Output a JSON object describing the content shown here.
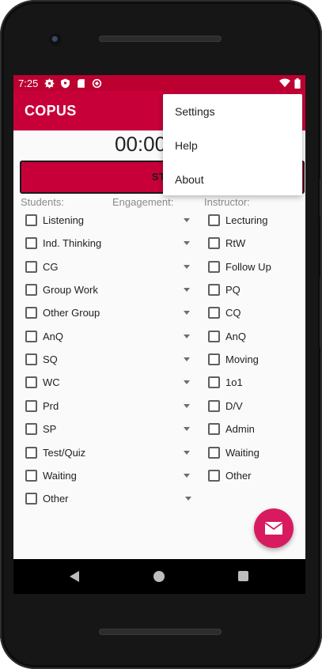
{
  "status_bar": {
    "time": "7:25",
    "icons": [
      "settings-gear-icon",
      "shield-icon",
      "sd-card-icon",
      "do-not-disturb-icon",
      "wifi-icon",
      "battery-icon"
    ]
  },
  "app_bar": {
    "title": "COPUS",
    "menu_icon": "more-vert-icon"
  },
  "timer": {
    "value": "00:00"
  },
  "start_button": {
    "label": "STA"
  },
  "columns": {
    "students": "Students:",
    "engagement": "Engagement:",
    "instructor": "Instructor:"
  },
  "students": [
    "Listening",
    "Ind. Thinking",
    "CG",
    "Group Work",
    "Other Group",
    "AnQ",
    "SQ",
    "WC",
    "Prd",
    "SP",
    "Test/Quiz",
    "Waiting",
    "Other"
  ],
  "instructor": [
    "Lecturing",
    "RtW",
    "Follow Up",
    "PQ",
    "CQ",
    "AnQ",
    "Moving",
    "1o1",
    "D/V",
    "Admin",
    "Waiting",
    "Other"
  ],
  "overflow_menu": {
    "items": [
      "Settings",
      "Help",
      "About"
    ]
  },
  "fab": {
    "icon": "email-icon"
  },
  "colors": {
    "accent": "#c8003a",
    "status_bar": "#bc0030",
    "fab": "#d81b60"
  }
}
